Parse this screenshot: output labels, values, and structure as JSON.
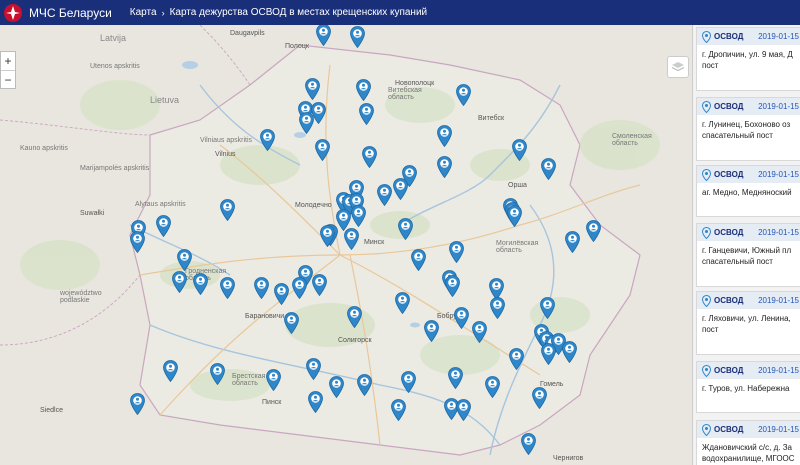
{
  "header": {
    "brand": "МЧС Беларуси",
    "breadcrumb_1": "Карта",
    "breadcrumb_2": "Карта дежурства ОСВОД в местах крещенских купаний",
    "separator": "›"
  },
  "map": {
    "zoom_in": "+",
    "zoom_out": "−",
    "labels": [
      {
        "id": "latvija",
        "text": "Latvija"
      },
      {
        "id": "lietuva",
        "text": "Lietuva"
      },
      {
        "id": "vilnius",
        "text": "Vilnius"
      },
      {
        "id": "vitebsk",
        "text": "Витебск"
      },
      {
        "id": "vitebsk_obl",
        "text": "Витебская область"
      },
      {
        "id": "orsha",
        "text": "Орша"
      },
      {
        "id": "smolensk_obl",
        "text": "Смоленская область"
      },
      {
        "id": "mogilev_obl",
        "text": "Могилёвская область"
      },
      {
        "id": "molodechno",
        "text": "Молодечно"
      },
      {
        "id": "minsk",
        "text": "Минск"
      },
      {
        "id": "grodno_obl",
        "text": "Гродненская область"
      },
      {
        "id": "baranovichi",
        "text": "Барановичи"
      },
      {
        "id": "bobruisk",
        "text": "Бобруйск"
      },
      {
        "id": "soligorsk",
        "text": "Солигорск"
      },
      {
        "id": "brest_obl",
        "text": "Брестская область"
      },
      {
        "id": "pinsk",
        "text": "Пинск"
      },
      {
        "id": "gomel",
        "text": "Гомель"
      },
      {
        "id": "chernigov",
        "text": "Чернигов"
      },
      {
        "id": "suwalki",
        "text": "Suwałki"
      },
      {
        "id": "podlaskie",
        "text": "województwo podlaskie"
      },
      {
        "id": "sedlce",
        "text": "Siedlce"
      },
      {
        "id": "novopolotsk",
        "text": "Новополоцк"
      },
      {
        "id": "polotsk",
        "text": "Полоцк"
      },
      {
        "id": "utenos",
        "text": "Utenos apskritis"
      },
      {
        "id": "alytaus",
        "text": "Alytaus apskritis"
      },
      {
        "id": "marijampoles",
        "text": "Marijampolės apskritis"
      },
      {
        "id": "vilniaus",
        "text": "Vilniaus apskritis"
      },
      {
        "id": "kaunas",
        "text": "Kauno apskritis"
      },
      {
        "id": "daugavpils",
        "text": "Daugavpils"
      }
    ]
  },
  "panel": {
    "cards": [
      {
        "type": "ОСВОД",
        "date": "2019-01-15",
        "address_1": "г. Дропичин, ул. 9 мая, Д",
        "address_2": "пост"
      },
      {
        "type": "ОСВОД",
        "date": "2019-01-15",
        "address_1": "г. Лунинец, Бохоново оз",
        "address_2": "спасательный пост"
      },
      {
        "type": "ОСВОД",
        "date": "2019-01-15",
        "address_1": "аг. Медно, Медняноский",
        "address_2": ""
      },
      {
        "type": "ОСВОД",
        "date": "2019-01-15",
        "address_1": "г. Ганцевичи, Южный пл",
        "address_2": "спасательный пост"
      },
      {
        "type": "ОСВОД",
        "date": "2019-01-15",
        "address_1": "г. Ляховичи, ул. Ленина,",
        "address_2": "пост"
      },
      {
        "type": "ОСВОД",
        "date": "2019-01-15",
        "address_1": "г. Туров, ул. Набережна",
        "address_2": ""
      },
      {
        "type": "ОСВОД",
        "date": "2019-01-15",
        "address_1": "Ждановичский с/с, д. За",
        "address_2": "водохранилище, МГООС"
      }
    ]
  },
  "colors": {
    "header_bg": "#1a2f7a",
    "pin": "#2f86c8",
    "date": "#2255bb"
  }
}
